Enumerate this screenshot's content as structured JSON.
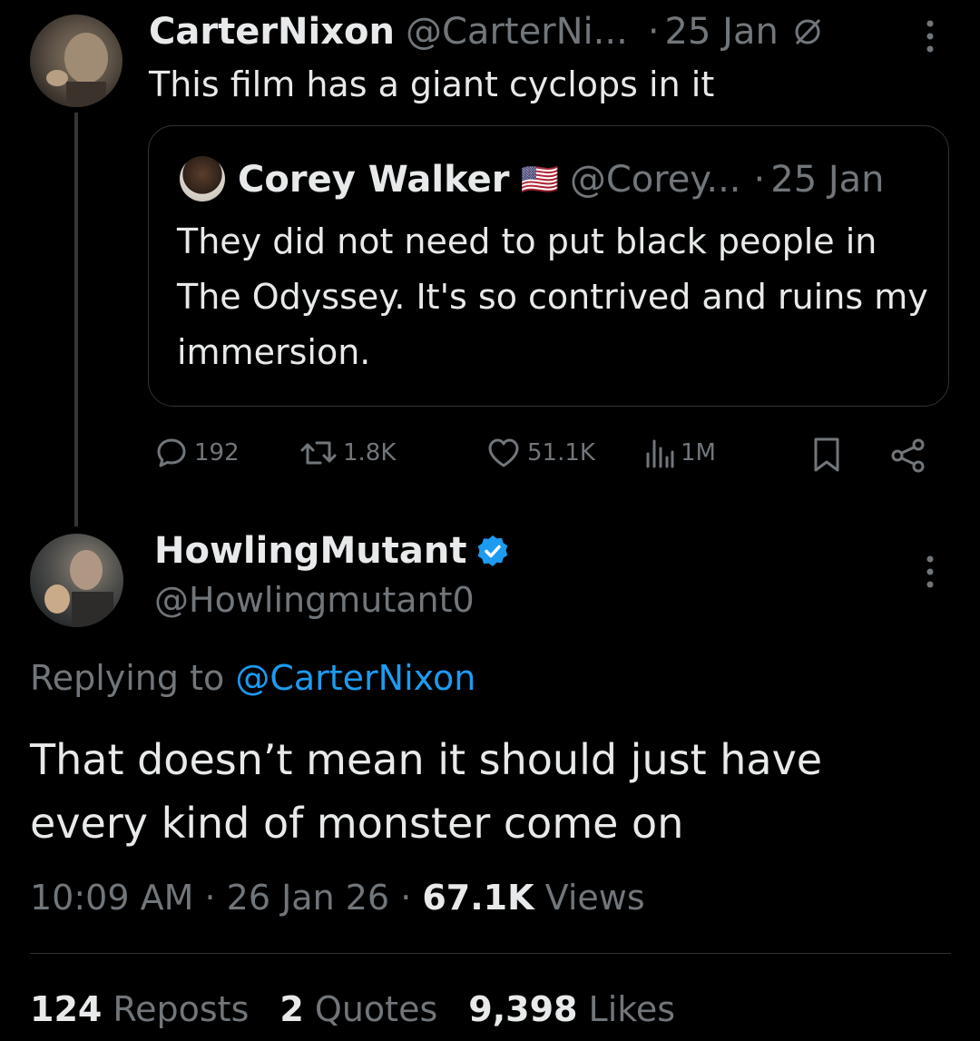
{
  "quoting_tweet": {
    "author_name": "CarterNixon",
    "author_handle": "@CarterNi...",
    "separator": "·",
    "date": "25 Jan",
    "text": "This film has a giant cyclops in it",
    "actions": {
      "replies": "192",
      "reposts": "1.8K",
      "likes": "51.1K",
      "views": "1M"
    }
  },
  "quoted_tweet": {
    "author_name": "Corey Walker",
    "flag": "🇺🇸",
    "author_handle": "@Corey...",
    "separator": "·",
    "date": "25 Jan",
    "text": "They did not need to put black people in The Odyssey. It's so contrived and ruins my immersion."
  },
  "reply_tweet": {
    "author_name": "HowlingMutant",
    "author_handle": "@Howlingmutant0",
    "replying_prefix": "Replying to",
    "replying_to": "@CarterNixon",
    "text": "That doesn’t mean it should just have every kind of monster come on",
    "time": "10:09 AM",
    "date": "26 Jan 26",
    "views_count": "67.1K",
    "views_label": "Views",
    "reposts_count": "124",
    "reposts_label": "Reposts",
    "quotes_count": "2",
    "quotes_label": "Quotes",
    "likes_count": "9,398",
    "likes_label": "Likes"
  },
  "colors": {
    "background": "#000000",
    "text": "#e7e9ea",
    "muted": "#71767b",
    "accent": "#1d9bf0",
    "border": "#2f3336"
  }
}
